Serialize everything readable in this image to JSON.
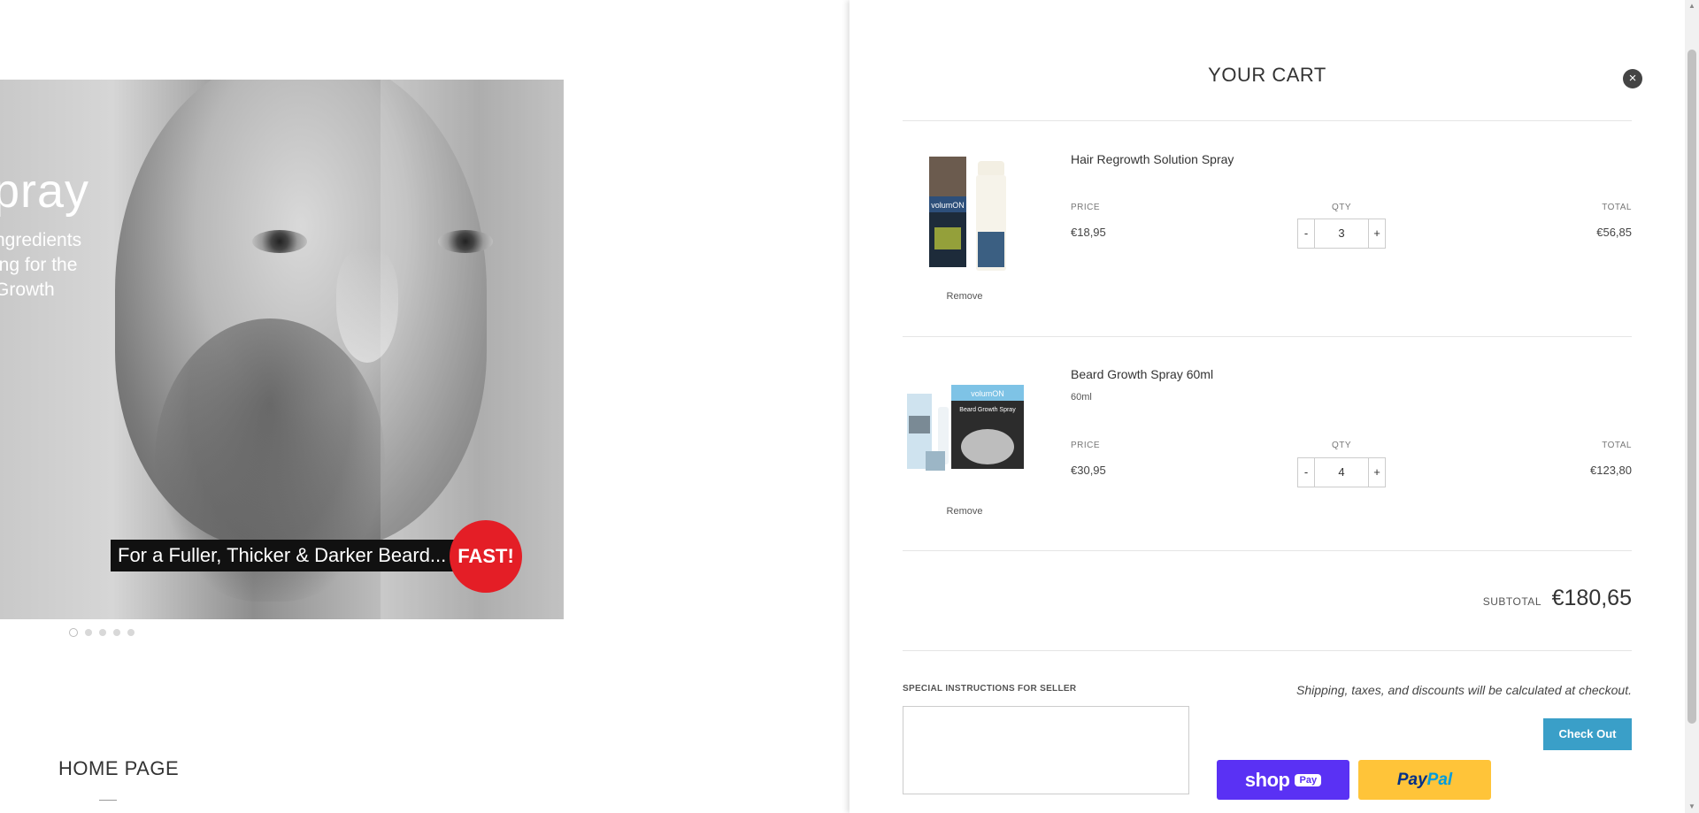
{
  "hero": {
    "title": "pray",
    "subtitle_lines": [
      "ngredients",
      "ing for the",
      "Growth"
    ],
    "banner_text": "For a Fuller, Thicker & Darker Beard...",
    "badge_text": "FAST!",
    "slide_count": 5,
    "active_slide": 1
  },
  "home": {
    "heading": "HOME PAGE"
  },
  "cart": {
    "title": "YOUR CART",
    "close_icon": "×",
    "column_labels": {
      "price": "PRICE",
      "qty": "QTY",
      "total": "TOTAL"
    },
    "items": [
      {
        "name": "Hair Regrowth Solution Spray",
        "variant": "",
        "price": "€18,95",
        "qty": "3",
        "total": "€56,85",
        "remove_label": "Remove",
        "product_text": "volumON"
      },
      {
        "name": "Beard Growth Spray 60ml",
        "variant": "60ml",
        "price": "€30,95",
        "qty": "4",
        "total": "€123,80",
        "remove_label": "Remove",
        "product_text": "volumON",
        "product_subtext": "Beard Growth Spray"
      }
    ],
    "qty_minus": "-",
    "qty_plus": "+",
    "subtotal_label": "SUBTOTAL",
    "subtotal_value": "€180,65",
    "instructions_label": "SPECIAL INSTRUCTIONS FOR SELLER",
    "instructions_value": "",
    "shipping_note": "Shipping, taxes, and discounts will be calculated at checkout.",
    "checkout_label": "Check Out",
    "shoppay": {
      "word": "shop",
      "pill": "Pay"
    },
    "paypal": {
      "pay": "Pay",
      "pal": "Pal"
    }
  },
  "colors": {
    "accent_checkout": "#3a9fc8",
    "shoppay": "#5a31f4",
    "paypal": "#ffc439",
    "badge_red": "#e41e26"
  }
}
